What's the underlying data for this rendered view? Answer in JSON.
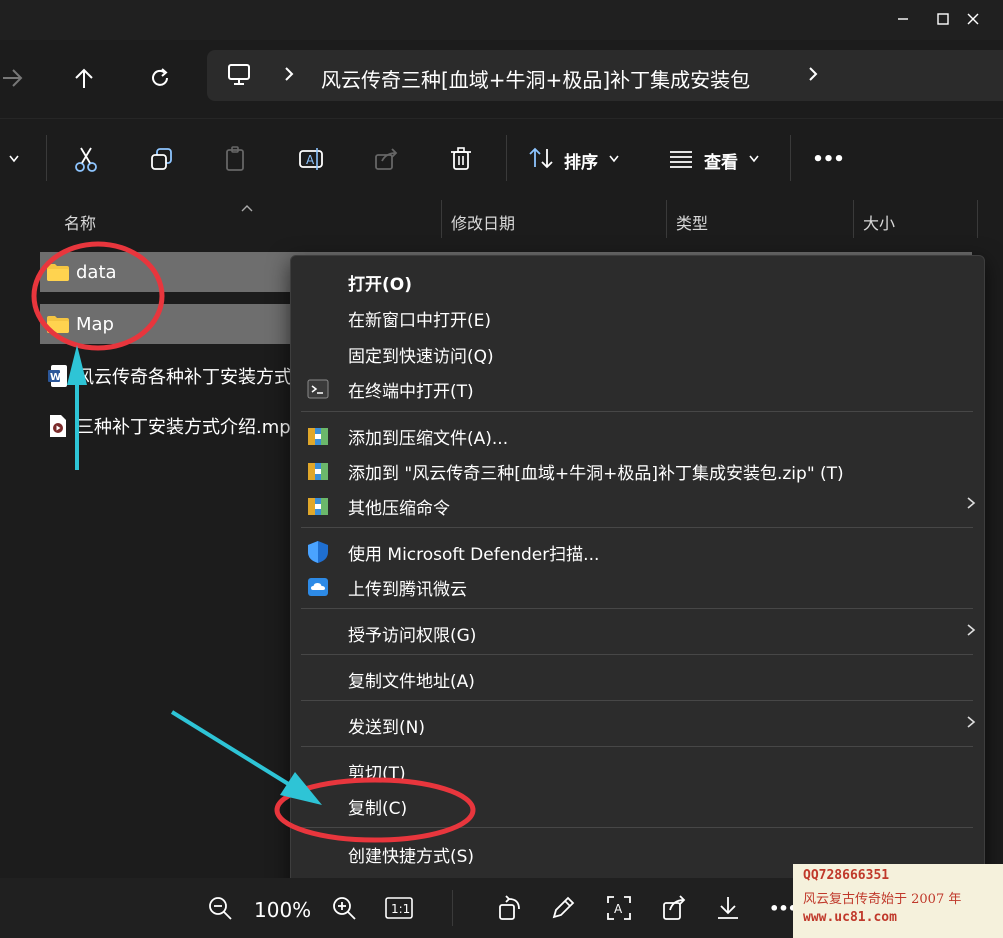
{
  "window": {
    "controls": [
      "minimize-icon",
      "maximize-icon",
      "close-icon"
    ]
  },
  "address": {
    "path": "风云传奇三种[血域+牛洞+极品]补丁集成安装包"
  },
  "toolbar": {
    "sort_label": "排序",
    "view_label": "查看",
    "more_label": "•••"
  },
  "columns": {
    "name": "名称",
    "modified": "修改日期",
    "type": "类型",
    "size": "大小"
  },
  "files": [
    {
      "name": "data",
      "icon": "folder-icon",
      "selected": true
    },
    {
      "name": "Map",
      "icon": "folder-icon",
      "selected": true
    },
    {
      "name": "风云传奇各种补丁安装方式",
      "icon": "word-doc-icon",
      "selected": false
    },
    {
      "name": "三种补丁安装方式介绍.mp",
      "icon": "video-file-icon",
      "selected": false
    }
  ],
  "context_menu": {
    "open": "打开(O)",
    "open_new_window": "在新窗口中打开(E)",
    "pin_quick_access": "固定到快速访问(Q)",
    "open_terminal": "在终端中打开(T)",
    "add_archive": "添加到压缩文件(A)...",
    "add_to_zip": "添加到 \"风云传奇三种[血域+牛洞+极品]补丁集成安装包.zip\" (T)",
    "other_compress": "其他压缩命令",
    "defender_scan": "使用 Microsoft Defender扫描...",
    "upload_weiyun": "上传到腾讯微云",
    "grant_access": "授予访问权限(G)",
    "copy_path": "复制文件地址(A)",
    "send_to": "发送到(N)",
    "cut": "剪切(T)",
    "copy": "复制(C)",
    "create_shortcut": "创建快捷方式(S)"
  },
  "viewer_bar": {
    "zoom": "100%",
    "actual_size": "1:1",
    "more": "•••"
  },
  "watermark": {
    "qq": "QQ728666351",
    "slogan": "风云复古传奇始于 2007 年",
    "site": "www.uc81.com"
  },
  "colors": {
    "annotation_red": "#e8363d",
    "annotation_cyan": "#2ec4d6",
    "menu_bg": "#2c2c2c",
    "selected_row": "#6e6e6e"
  }
}
